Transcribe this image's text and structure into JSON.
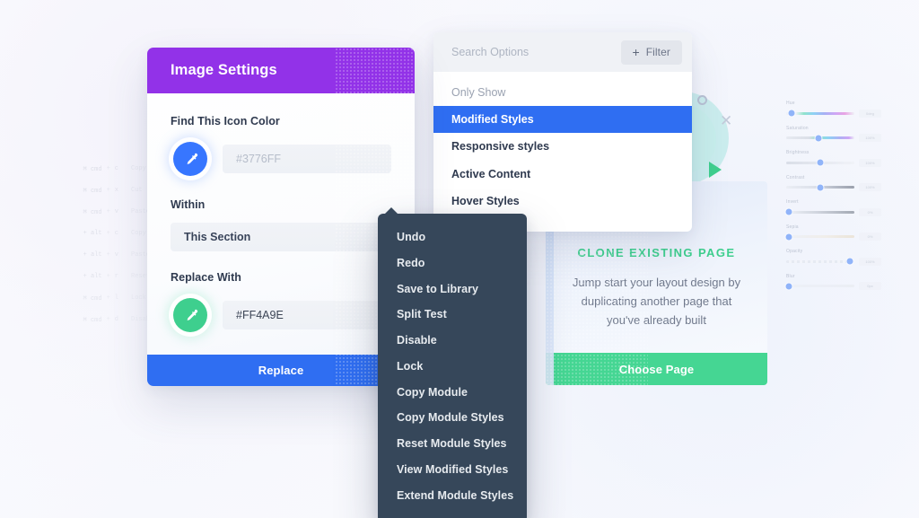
{
  "image_settings": {
    "title": "Image Settings",
    "find_label": "Find This Icon Color",
    "find_placeholder": "#3776FF",
    "find_value": "",
    "within_label": "Within",
    "within_value": "This Section",
    "replace_label": "Replace With",
    "replace_value": "#FF4A9E",
    "replace_button": "Replace",
    "find_dropper_icon": "eyedropper-icon",
    "replace_dropper_icon": "eyedropper-icon",
    "header_color": "#9232E8",
    "find_color": "#3776FF",
    "replace_color": "#FF4A9E",
    "button_color": "#2F6EF2"
  },
  "search_panel": {
    "search_placeholder": "Search Options",
    "search_value": "",
    "filter_button": "Filter",
    "filter_icon": "plus-icon",
    "group_heading": "Only Show",
    "options": [
      {
        "label": "Modified Styles",
        "active": true
      },
      {
        "label": "Responsive styles",
        "active": false
      },
      {
        "label": "Active Content",
        "active": false
      },
      {
        "label": "Hover Styles",
        "active": false
      }
    ],
    "active_color": "#2F6EF2"
  },
  "context_menu": {
    "items": [
      "Undo",
      "Redo",
      "Save to Library",
      "Split Test",
      "Disable",
      "Lock",
      "Copy Module",
      "Copy Module Styles",
      "Reset Module Styles",
      "View Modified Styles",
      "Extend Module Styles"
    ],
    "background_color": "#36475A"
  },
  "clone_card": {
    "heading": "CLONE EXISTING PAGE",
    "description": "Jump start your layout design by duplicating another page that you've already built",
    "button": "Choose Page",
    "heading_color": "#3ECF8E",
    "button_color": "#45D693"
  },
  "illustration": {
    "play_icon": "play-triangle-icon",
    "ring_icon": "circle-outline-icon",
    "close_icon": "close-x-icon"
  },
  "filters_panel": {
    "sliders": [
      {
        "label": "Hue",
        "value": "0deg",
        "knob": 8,
        "track": "tr-hue"
      },
      {
        "label": "Saturation",
        "value": "100%",
        "knob": 48,
        "track": "tr-sat"
      },
      {
        "label": "Brightness",
        "value": "100%",
        "knob": 50,
        "track": "tr-bri"
      },
      {
        "label": "Contrast",
        "value": "100%",
        "knob": 50,
        "track": "tr-con"
      },
      {
        "label": "Invert",
        "value": "0%",
        "knob": 4,
        "track": "tr-inv"
      },
      {
        "label": "Sepia",
        "value": "0%",
        "knob": 4,
        "track": "tr-sep"
      },
      {
        "label": "Opacity",
        "value": "100%",
        "knob": 94,
        "track": "tr-opa"
      },
      {
        "label": "Blur",
        "value": "0px",
        "knob": 4,
        "track": "tr-blur"
      }
    ]
  },
  "shortcuts": {
    "rows": [
      {
        "mod": "⌘ cmd",
        "plus": "+",
        "key": "c",
        "desc": "Copy"
      },
      {
        "mod": "⌘ cmd",
        "plus": "+",
        "key": "x",
        "desc": "Cut"
      },
      {
        "mod": "⌘ cmd",
        "plus": "+",
        "key": "v",
        "desc": "Paste"
      },
      {
        "mod": "+ alt",
        "plus": "+",
        "key": "c",
        "desc": "Copy"
      },
      {
        "mod": "+ alt",
        "plus": "+",
        "key": "v",
        "desc": "Paste"
      },
      {
        "mod": "+ alt",
        "plus": "+",
        "key": "r",
        "desc": "Reset"
      },
      {
        "mod": "⌘ cmd",
        "plus": "+",
        "key": "l",
        "desc": "Lock"
      },
      {
        "mod": "⌘ cmd",
        "plus": "+",
        "key": "d",
        "desc": "Disable"
      }
    ]
  }
}
